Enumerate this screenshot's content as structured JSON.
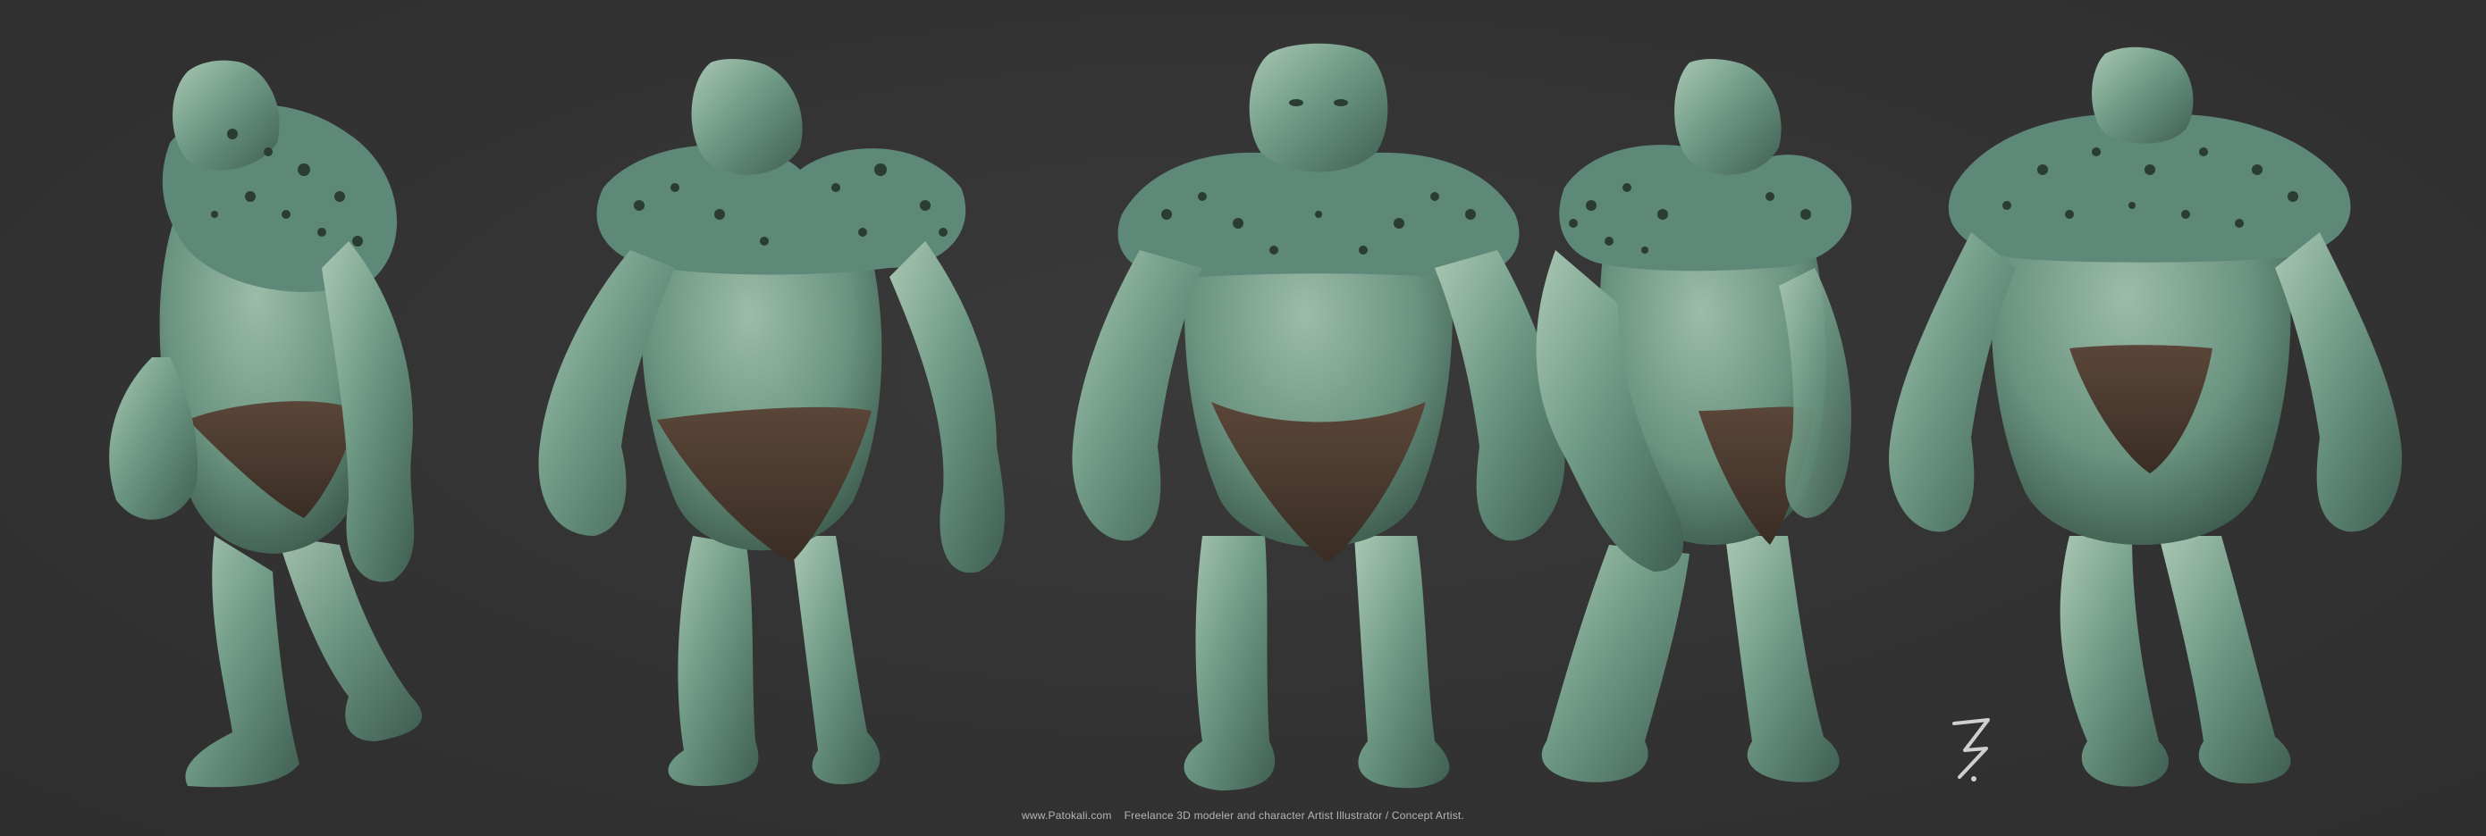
{
  "image": {
    "subject": "turnaround of a sculpted green spiked troll-like creature",
    "views": [
      "left-profile",
      "three-quarter-left",
      "front",
      "three-quarter-right",
      "back"
    ],
    "colors": {
      "background": "#333333",
      "skin": "#6f9a86",
      "skin_dark": "#3f5f52",
      "skin_light": "#a9c7b3",
      "spikes": "#2a3c34",
      "loincloth": "#4a3a30",
      "footer_text": "#b5b5b5"
    }
  },
  "footer": {
    "site": "www.Patokali.com",
    "tagline": "Freelance 3D modeler and character Artist Illustrator / Concept Artist."
  }
}
